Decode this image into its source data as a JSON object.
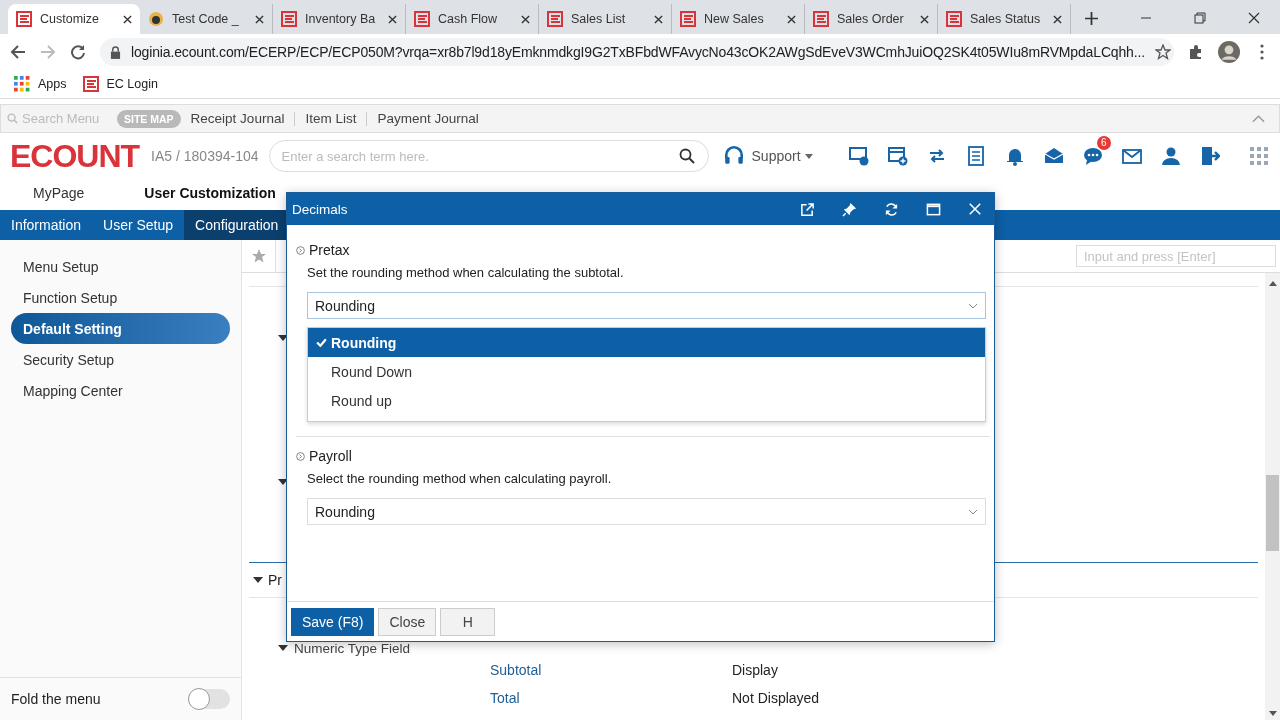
{
  "browser": {
    "tabs": [
      {
        "label": "Customize",
        "selected": true,
        "kind": "ecount"
      },
      {
        "label": "Test Code _",
        "selected": false,
        "kind": "avatar"
      },
      {
        "label": "Inventory Ba",
        "selected": false,
        "kind": "ecount"
      },
      {
        "label": "Cash Flow",
        "selected": false,
        "kind": "ecount"
      },
      {
        "label": "Sales List",
        "selected": false,
        "kind": "ecount"
      },
      {
        "label": "New Sales",
        "selected": false,
        "kind": "ecount"
      },
      {
        "label": "Sales Order",
        "selected": false,
        "kind": "ecount"
      },
      {
        "label": "Sales Status",
        "selected": false,
        "kind": "ecount"
      }
    ],
    "url": "loginia.ecount.com/ECERP/ECP/ECP050M?vrqa=xr8b7l9d18yEmknmdkgI9G2TxBFbdWFAvycNo43cOK2AWgSdEveV3WCmhJuiOQ2SK4t05WIu8mRVMpdaLCqhh...",
    "bookmarks": [
      {
        "label": "Apps",
        "kind": "apps"
      },
      {
        "label": "EC Login",
        "kind": "ecount"
      }
    ]
  },
  "quick_bar": {
    "search_placeholder": "Search Menu",
    "site_map": "SITE MAP",
    "links": [
      "Receipt Journal",
      "Item List",
      "Payment Journal"
    ]
  },
  "header": {
    "logo": "ECOUNT",
    "company": "IA5 / 180394-104",
    "search": {
      "placeholder": "Enter a search term here."
    },
    "support": "Support",
    "notification_count": "6"
  },
  "main_menu": [
    {
      "label": "MyPage",
      "selected": false
    },
    {
      "label": "User Customization",
      "selected": true
    }
  ],
  "sub_menu": [
    {
      "label": "Information",
      "selected": false
    },
    {
      "label": "User Setup",
      "selected": false
    },
    {
      "label": "Configuration",
      "selected": true
    }
  ],
  "sidebar": {
    "items": [
      {
        "label": "Menu Setup",
        "selected": false
      },
      {
        "label": "Function Setup",
        "selected": false
      },
      {
        "label": "Default Setting",
        "selected": true
      },
      {
        "label": "Security Setup",
        "selected": false
      },
      {
        "label": "Mapping Center",
        "selected": false
      }
    ],
    "fold": {
      "label": "Fold the menu",
      "on": false
    }
  },
  "content": {
    "filter": {
      "placeholder": "Input and press [Enter]"
    },
    "section_label": "Pr",
    "group_label": "Numeric Type Field",
    "rows": [
      {
        "name": "Subtotal",
        "value": "Display"
      },
      {
        "name": "Total",
        "value": "Not Displayed"
      }
    ]
  },
  "dialog": {
    "title": "Decimals",
    "sections": [
      {
        "title": "Pretax",
        "description": "Set the rounding method when calculating the subtotal.",
        "value": "Rounding",
        "open": true
      },
      {
        "title": "Payroll",
        "description": "Select the rounding method when calculating payroll.",
        "value": "Rounding",
        "open": false
      }
    ],
    "options": [
      {
        "label": "Rounding",
        "selected": true
      },
      {
        "label": "Round Down",
        "selected": false
      },
      {
        "label": "Round up",
        "selected": false
      }
    ],
    "buttons": [
      {
        "label": "Save (F8)",
        "kind": "primary"
      },
      {
        "label": "Close",
        "kind": "default"
      },
      {
        "label": "H",
        "kind": "default"
      }
    ]
  }
}
